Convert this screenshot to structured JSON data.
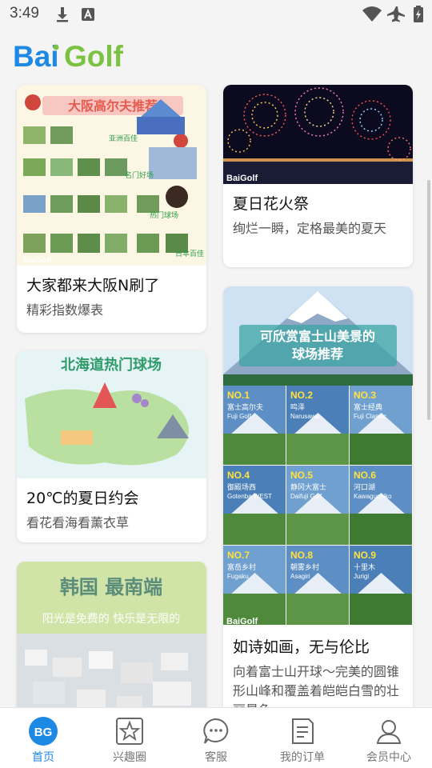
{
  "status_bar": {
    "time": "3:49",
    "icons": [
      "download-icon",
      "text-notification-icon",
      "wifi-icon",
      "airplane-icon",
      "battery-icon"
    ]
  },
  "brand": {
    "logo_text": "BaiGolf",
    "accent": "#1e88e5",
    "logo_green": "#7cc242"
  },
  "feed": {
    "left": [
      {
        "title": "大家都来大阪N刷了",
        "subtitle": "精彩指数爆表",
        "image_text": {
          "banner": "大阪高尔夫推荐",
          "tags": [
            "亚洲百佳",
            "名门好场",
            "热门球场",
            "日本百佳"
          ],
          "watermark": "BaiGolf"
        }
      },
      {
        "title": "20℃的夏日约会",
        "subtitle": "看花看海看薰衣草",
        "image_text": {
          "banner": "北海道热门球场"
        }
      },
      {
        "title": "",
        "subtitle": "",
        "image_text": {
          "banner": "韩国 最南端",
          "tagline": "阳光是免费的 快乐是无限的"
        }
      }
    ],
    "right": [
      {
        "title": "夏日花火祭",
        "subtitle": "绚烂一瞬，定格最美的夏天",
        "image_text": {
          "watermark": "BaiGolf"
        }
      },
      {
        "title": "如诗如画，无与伦比",
        "subtitle": "向着富士山开球～完美的圆锥形山峰和覆盖着皑皑白雪的壮丽景色",
        "image_text": {
          "banner_line1": "可欣赏富士山美景的",
          "banner_line2": "球场推荐",
          "watermark": "BaiGolf",
          "grid": [
            {
              "no": "NO.1",
              "cn": "富士高尔夫",
              "en": "Fuji Golf"
            },
            {
              "no": "NO.2",
              "cn": "鸣泽",
              "en": "Narusawa"
            },
            {
              "no": "NO.3",
              "cn": "富士经典",
              "en": "Fuji Classic"
            },
            {
              "no": "NO.4",
              "cn": "御殿场西",
              "en": "Gotenba WEST"
            },
            {
              "no": "NO.5",
              "cn": "静冈大富士",
              "en": "Daifuji Golf"
            },
            {
              "no": "NO.6",
              "cn": "河口湖",
              "en": "Kawaguchiko"
            },
            {
              "no": "NO.7",
              "cn": "富岳乡村",
              "en": "Fugaku"
            },
            {
              "no": "NO.8",
              "cn": "朝雾乡村",
              "en": "Asagiri"
            },
            {
              "no": "NO.9",
              "cn": "十里木",
              "en": "Jurigi"
            }
          ]
        }
      }
    ]
  },
  "bottom_nav": [
    {
      "label": "首页",
      "icon": "home-bg-icon",
      "badge": "BG",
      "active": true
    },
    {
      "label": "兴趣圈",
      "icon": "star-icon",
      "active": false
    },
    {
      "label": "客服",
      "icon": "chat-icon",
      "active": false
    },
    {
      "label": "我的订单",
      "icon": "order-icon",
      "active": false
    },
    {
      "label": "会员中心",
      "icon": "user-icon",
      "active": false
    }
  ]
}
